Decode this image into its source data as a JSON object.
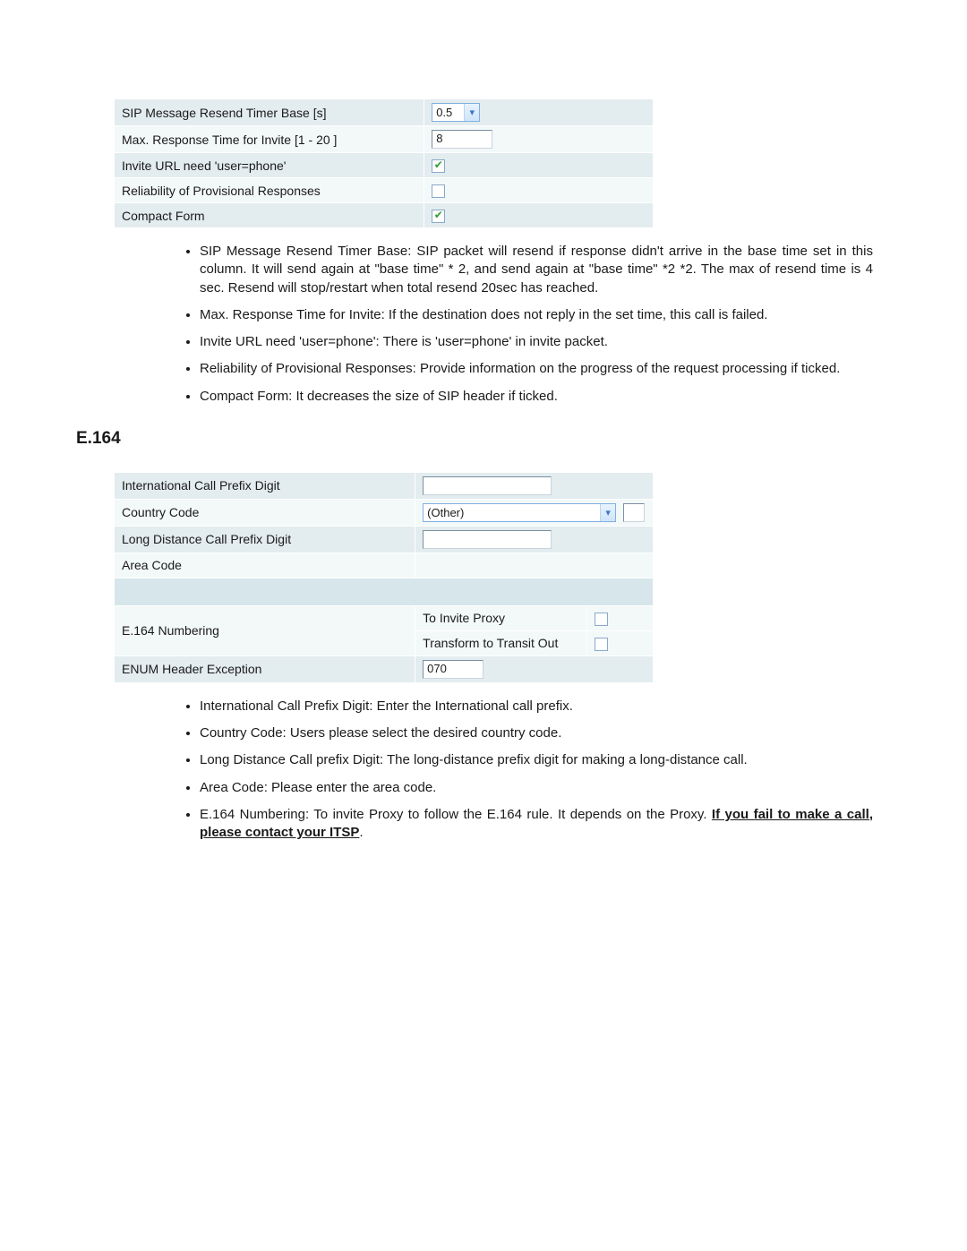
{
  "sip_table": {
    "rows": [
      {
        "label": "SIP Message Resend Timer Base [s]",
        "type": "select-small",
        "value": "0.5"
      },
      {
        "label": "Max. Response Time for Invite [1 - 20 ]",
        "type": "text",
        "value": "8"
      },
      {
        "label": "Invite URL need 'user=phone'",
        "type": "checkbox",
        "checked": true
      },
      {
        "label": "Reliability of Provisional Responses",
        "type": "checkbox",
        "checked": false
      },
      {
        "label": "Compact Form",
        "type": "checkbox",
        "checked": true
      }
    ]
  },
  "sip_bullets": [
    "SIP Message Resend Timer Base: SIP packet will resend if response didn't arrive in the base time set in this column. It will send again at \"base time\" * 2, and send again at \"base time\" *2 *2. The max of resend time is 4 sec. Resend will stop/restart when total resend 20sec has reached.",
    "Max. Response Time for Invite: If the destination does not reply in the set time, this call is failed.",
    "Invite URL need 'user=phone': There is 'user=phone' in invite packet.",
    "Reliability of Provisional Responses: Provide information on the progress of the request processing if ticked.",
    "Compact Form: It decreases the size of SIP header if ticked."
  ],
  "section_heading": "E.164",
  "e164_table": {
    "rows_top": [
      {
        "label": "International Call Prefix Digit",
        "type": "text-med",
        "value": ""
      },
      {
        "label": "Country Code",
        "type": "select-wide",
        "value": "(Other)",
        "extra_box": true
      },
      {
        "label": "Long Distance Call Prefix Digit",
        "type": "text-med",
        "value": ""
      },
      {
        "label": "Area Code",
        "type": "none"
      }
    ],
    "numbering_label": "E.164 Numbering",
    "numbering_rows": [
      {
        "label": "To Invite Proxy",
        "checked": false
      },
      {
        "label": "Transform to Transit Out",
        "checked": false
      }
    ],
    "enum_row": {
      "label": "ENUM Header Exception",
      "type": "text",
      "value": "070"
    }
  },
  "e164_bullets_plain": [
    "International Call Prefix Digit: Enter the International call prefix.",
    "Country Code: Users please select the desired country code.",
    "Long Distance Call prefix Digit: The long-distance prefix digit for making a long-distance call.",
    "Area Code: Please enter the area code."
  ],
  "e164_bullet_special": {
    "prefix": "E.164 Numbering: To invite Proxy to follow the E.164 rule. It depends on the Proxy. ",
    "bold_part": "If you fail to make a call, please contact your ITSP",
    "suffix": "."
  }
}
